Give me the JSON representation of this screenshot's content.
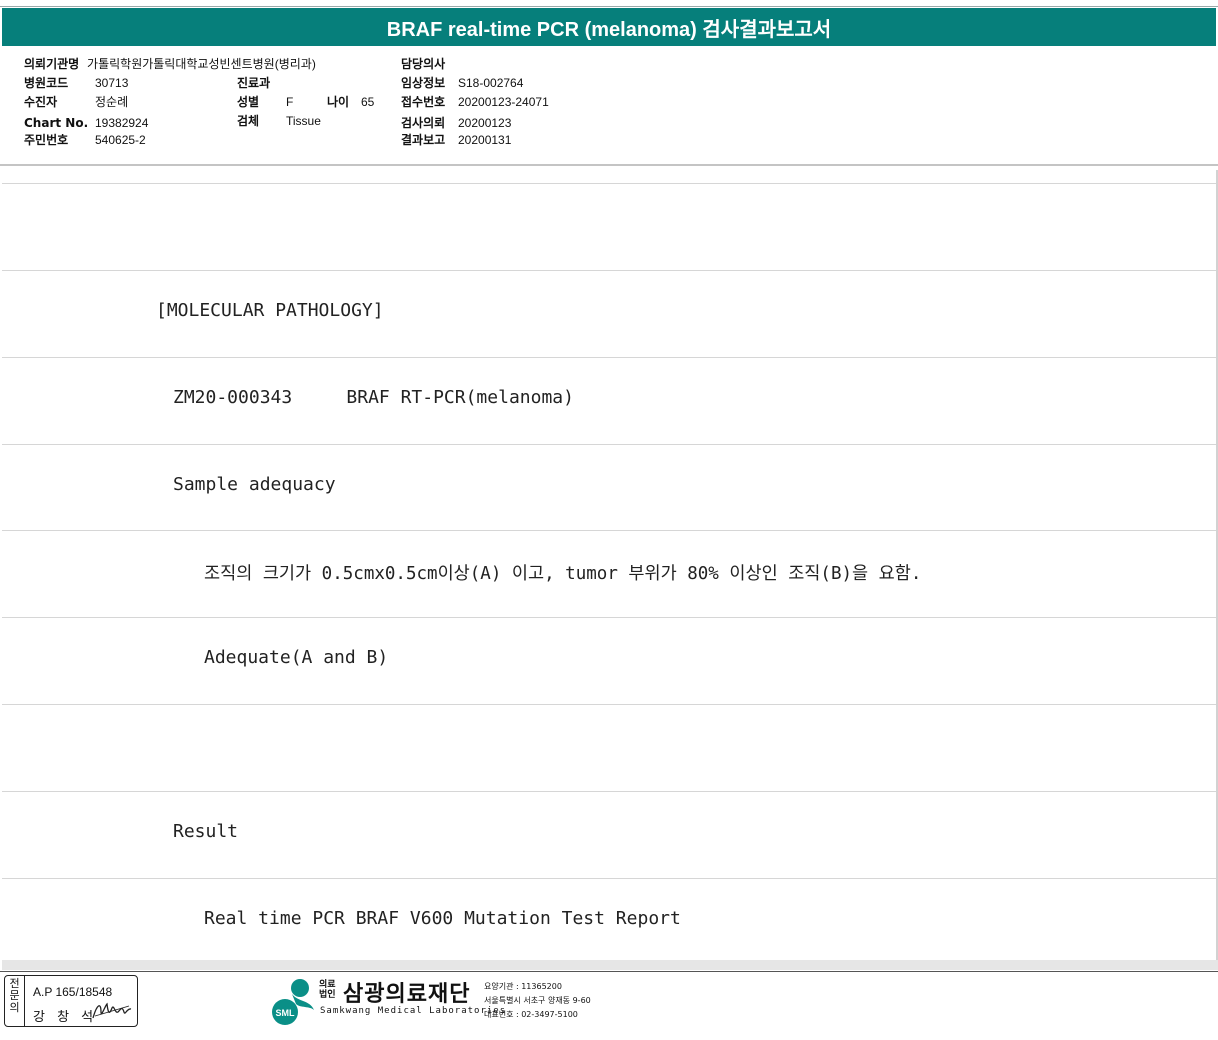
{
  "report": {
    "title": "BRAF real-time PCR (melanoma) 검사결과보고서"
  },
  "header": {
    "institution_label": "의뢰기관명",
    "institution_value": "가톨릭학원가톨릭대학교성빈센트병원(병리과)",
    "hospital_code_label": "병원코드",
    "hospital_code_value": "30713",
    "patient_label": "수진자",
    "patient_value": "정순례",
    "chart_label": "Chart No.",
    "chart_value": "19382924",
    "resident_label": "주민번호",
    "resident_value": "540625-2",
    "department_label": "진료과",
    "department_value": "",
    "sex_label": "성별",
    "sex_value": "F",
    "age_label": "나이",
    "age_value": "65",
    "specimen_label": "검체",
    "specimen_value": "Tissue",
    "doctor_label": "담당의사",
    "doctor_value": "",
    "clinical_label": "임상정보",
    "clinical_value": "S18-002764",
    "receipt_label": "접수번호",
    "receipt_value": "20200123-24071",
    "request_label": "검사의뢰",
    "request_value": "20200123",
    "result_date_label": "결과보고",
    "result_date_value": "20200131"
  },
  "body_lines": [
    "",
    "[MOLECULAR PATHOLOGY]",
    "ZM20-000343     BRAF RT-PCR(melanoma)",
    "Sample adequacy",
    "조직의 크기가 0.5cmx0.5cm이상(A) 이고, tumor 부위가 80% 이상인 조직(B)을 요함.",
    "Adequate(A and B)",
    "",
    "Result",
    "Real time PCR BRAF V600 Mutation Test Report"
  ],
  "footer": {
    "stamp_side": "전문의",
    "stamp_ap": "A.P 165/18548",
    "stamp_name": "강 창 석",
    "org_small_1": "의료",
    "org_small_2": "법인",
    "org_name": "삼광의료재단",
    "org_en": "Samkwang Medical Laboratories",
    "logo_text": "SML",
    "info_code": "요양기관 : 11365200",
    "info_addr": "서울특별시 서초구 양재동 9-60",
    "info_phone": "대표번호 : 02-3497-5100"
  }
}
